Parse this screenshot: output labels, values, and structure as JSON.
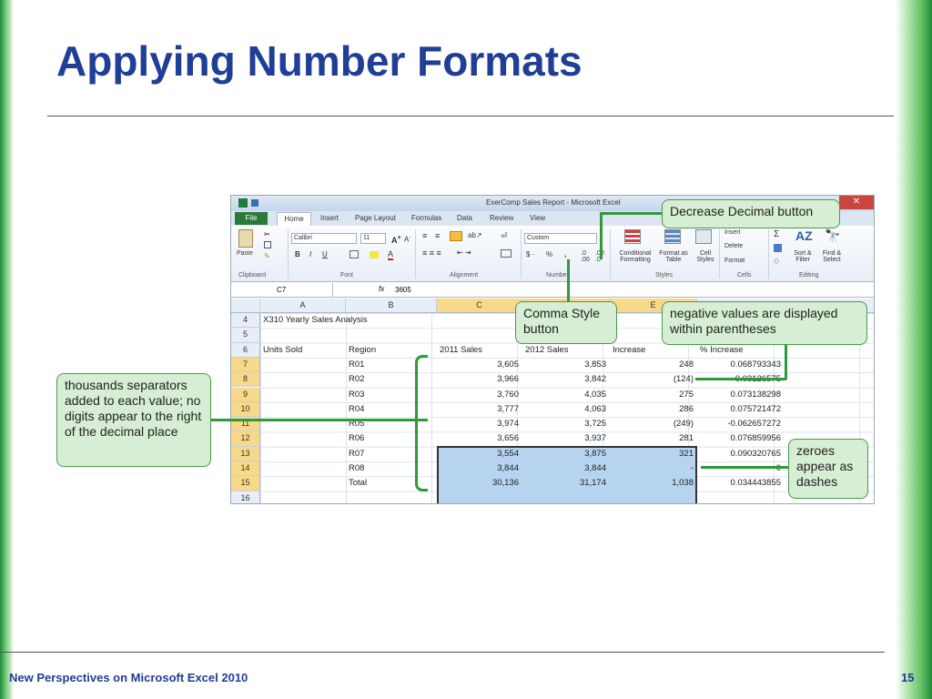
{
  "slide": {
    "title": "Applying Number Formats",
    "footer_left": "New Perspectives on Microsoft Excel 2010",
    "page_number": "15"
  },
  "excel": {
    "window_title": "ExerComp Sales Report - Microsoft Excel",
    "tabs": [
      "File",
      "Home",
      "Insert",
      "Page Layout",
      "Formulas",
      "Data",
      "Review",
      "View"
    ],
    "ribbon": {
      "font_name": "Calibri",
      "font_size": "11",
      "number_format": "Custom",
      "paste_label": "Paste",
      "groups": [
        "Clipboard",
        "Font",
        "Alignment",
        "Number",
        "Styles",
        "Cells",
        "Editing"
      ],
      "styles_buttons": [
        "Conditional Formatting",
        "Format as Table",
        "Cell Styles"
      ],
      "cells_buttons": [
        "Insert",
        "Delete",
        "Format"
      ],
      "editing_buttons": [
        "Sort & Filter",
        "Find & Select"
      ]
    },
    "name_box": "C7",
    "formula_value": "3605",
    "columns": [
      "A",
      "B",
      "C",
      "D",
      "E"
    ],
    "rows": [
      {
        "num": "4",
        "a": "X310 Yearly Sales Analysis",
        "b": "",
        "c": "",
        "d": "",
        "e": "",
        "f": ""
      },
      {
        "num": "5",
        "a": "",
        "b": "",
        "c": "",
        "d": "",
        "e": "",
        "f": ""
      },
      {
        "num": "6",
        "a": "Units Sold",
        "b": "Region",
        "c": "2011 Sales",
        "d": "2012 Sales",
        "e": "Increase",
        "f": "% Increase"
      },
      {
        "num": "7",
        "a": "",
        "b": "R01",
        "c": "3,605",
        "d": "3,853",
        "e": "248",
        "f": "0.068793343"
      },
      {
        "num": "8",
        "a": "",
        "b": "R02",
        "c": "3,966",
        "d": "3,842",
        "e": "(124)",
        "f": "-0.03126575"
      },
      {
        "num": "9",
        "a": "",
        "b": "R03",
        "c": "3,760",
        "d": "4,035",
        "e": "275",
        "f": "0.073138298"
      },
      {
        "num": "10",
        "a": "",
        "b": "R04",
        "c": "3,777",
        "d": "4,063",
        "e": "286",
        "f": "0.075721472"
      },
      {
        "num": "11",
        "a": "",
        "b": "R05",
        "c": "3,974",
        "d": "3,725",
        "e": "(249)",
        "f": "-0.062657272"
      },
      {
        "num": "12",
        "a": "",
        "b": "R06",
        "c": "3,656",
        "d": "3,937",
        "e": "281",
        "f": "0.076859956"
      },
      {
        "num": "13",
        "a": "",
        "b": "R07",
        "c": "3,554",
        "d": "3,875",
        "e": "321",
        "f": "0.090320765"
      },
      {
        "num": "14",
        "a": "",
        "b": "R08",
        "c": "3,844",
        "d": "3,844",
        "e": "-",
        "f": "0"
      },
      {
        "num": "15",
        "a": "",
        "b": "Total",
        "c": "30,136",
        "d": "31,174",
        "e": "1,038",
        "f": "0.034443855"
      },
      {
        "num": "16",
        "a": "",
        "b": "",
        "c": "",
        "d": "",
        "e": "",
        "f": ""
      }
    ]
  },
  "callouts": {
    "decrease_decimal": "Decrease Decimal button",
    "comma_style": "Comma Style button",
    "negative_values": "negative values are displayed within parentheses",
    "thousands": "thousands separators added to each value; no digits appear to the right of the decimal place",
    "zeroes": "zeroes appear as dashes"
  },
  "colors": {
    "title": "#1f3e96",
    "callout_bg": "#d6eed3",
    "callout_border": "#4a9a4a",
    "selection": "#b6d3ef"
  }
}
